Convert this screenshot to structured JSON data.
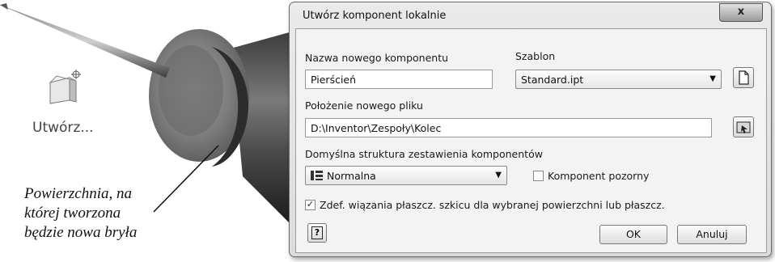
{
  "scene": {
    "create_label": "Utwórz...",
    "caption": "Powierzchnia, na\nktórej tworzona\nbędzie nowa bryła"
  },
  "dialog": {
    "title": "Utwórz komponent lokalnie",
    "close_glyph": "x",
    "name_label": "Nazwa nowego komponentu",
    "name_value": "Pierścień",
    "template_label": "Szablon",
    "template_value": "Standard.ipt",
    "location_label": "Położenie nowego pliku",
    "location_value": "D:\\Inventor\\Zespoły\\Kolec",
    "structure_label": "Domyślna struktura zestawienia komponentów",
    "structure_value": "Normalna",
    "virtual_label": "Komponent pozorny",
    "virtual_checked": false,
    "constraint_label": "Zdef. wiązania płaszcz. szkicu dla wybranej powierzchni lub płaszcz.",
    "constraint_checked": true,
    "help_glyph": "?",
    "ok_label": "OK",
    "cancel_label": "Anuluj"
  },
  "icons": [
    "create-component-icon",
    "new-template-icon",
    "browse-folder-icon",
    "structure-list-icon",
    "help-icon",
    "close-icon",
    "chevron-down-icon"
  ]
}
